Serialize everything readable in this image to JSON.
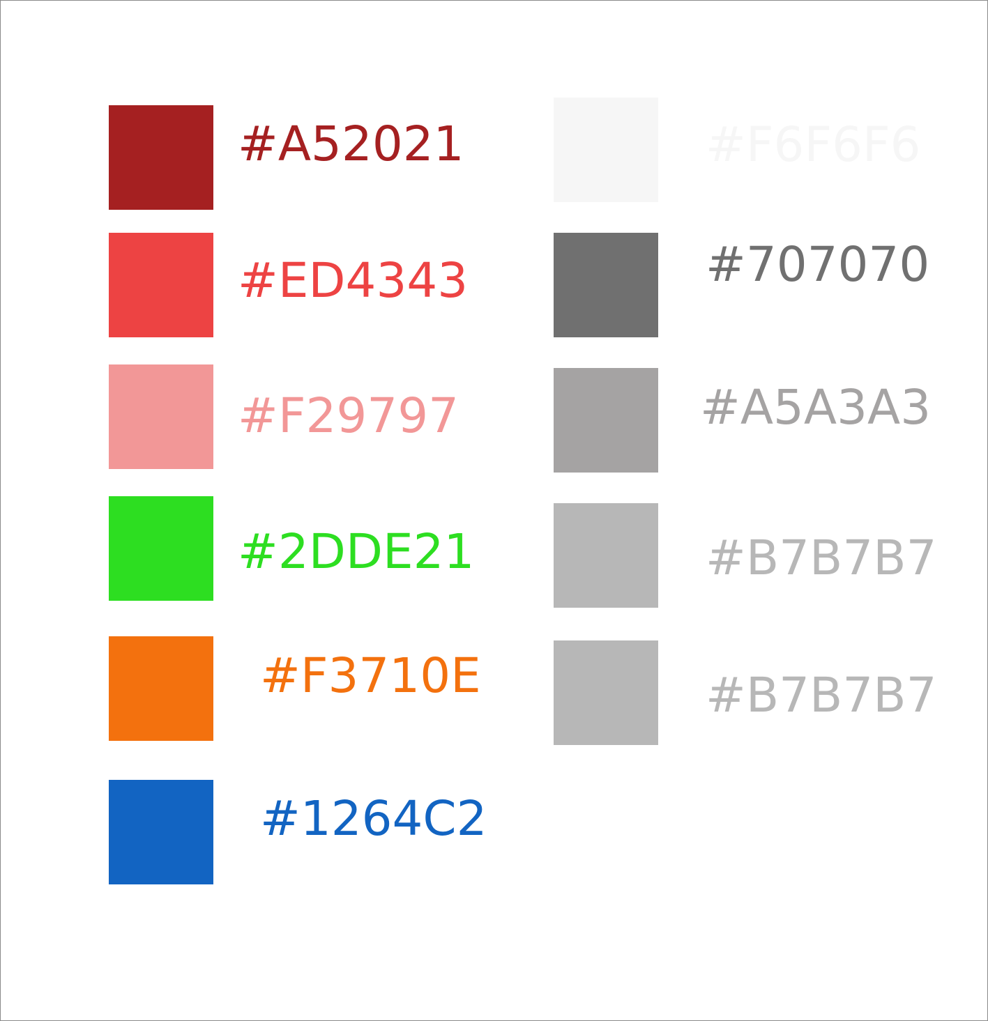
{
  "palette": {
    "left_column": [
      {
        "label": "#A52021",
        "color": "#A52021"
      },
      {
        "label": "#ED4343",
        "color": "#ED4343"
      },
      {
        "label": "#F29797",
        "color": "#F29797"
      },
      {
        "label": "#2DDE21",
        "color": "#2DDE21"
      },
      {
        "label": "#F3710E",
        "color": "#F3710E"
      },
      {
        "label": "#1264C2",
        "color": "#1264C2"
      }
    ],
    "right_column": [
      {
        "label": "#F6F6F6",
        "color": "#F6F6F6"
      },
      {
        "label": "#707070",
        "color": "#707070"
      },
      {
        "label": "#A5A3A3",
        "color": "#A5A3A3"
      },
      {
        "label": "#B7B7B7",
        "color": "#B7B7B7"
      },
      {
        "label": "#B7B7B7",
        "color": "#B7B7B7"
      }
    ]
  }
}
